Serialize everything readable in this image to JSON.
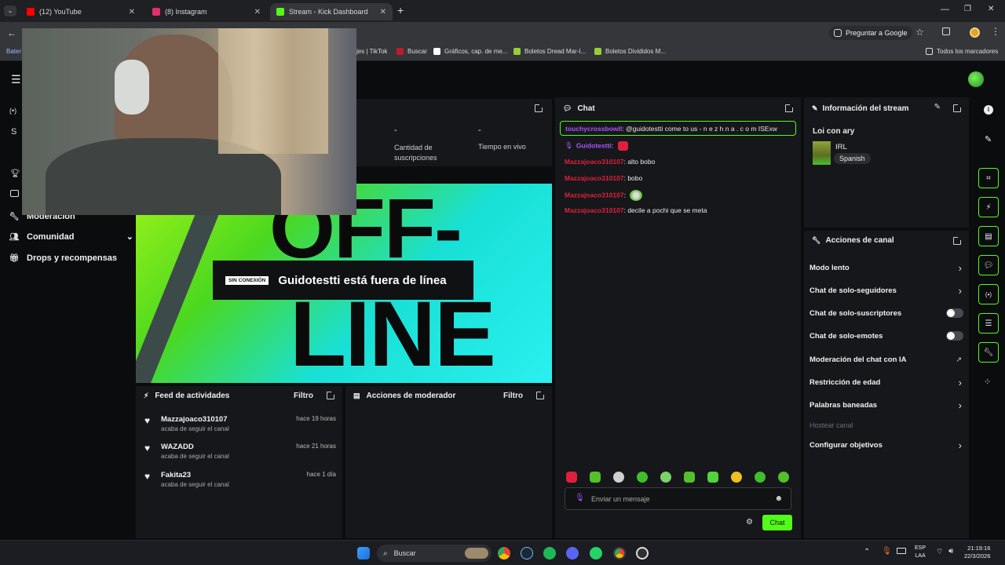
{
  "browser": {
    "tabs": [
      {
        "title": "(12) YouTube",
        "favicon": "youtube-icon",
        "color": "#ff0000"
      },
      {
        "title": "(8) Instagram",
        "favicon": "instagram-icon",
        "color": "#e1306c"
      },
      {
        "title": "Stream - Kick Dashboard",
        "favicon": "kick-icon",
        "color": "#53fc18"
      }
    ],
    "ask_google": "Preguntar a Google",
    "bookmarks": [
      {
        "label": "Bater",
        "icon": "bookmark-icon"
      },
      {
        "label": "jes | TikTok",
        "icon": "tiktok-icon"
      },
      {
        "label": "Buscar",
        "icon": "buscar-icon"
      },
      {
        "label": "Gráficos, cap. de me...",
        "icon": "capcut-icon"
      },
      {
        "label": "Boletos Dread Mar-I...",
        "icon": "ticket-icon"
      },
      {
        "label": "Boletos Divididos M...",
        "icon": "ticket-icon"
      }
    ],
    "all_bookmarks": "Todos los marcadores"
  },
  "sidebar": {
    "items": [
      {
        "label": "Moderación",
        "icon": "wrench-icon"
      },
      {
        "label": "Comunidad",
        "icon": "community-icon"
      },
      {
        "label": "Drops y recompensas",
        "icon": "gift-icon"
      }
    ]
  },
  "stats": [
    {
      "value": "-",
      "label": "Cantidad de suscripciones"
    },
    {
      "value": "-",
      "label": "Tiempo en vivo"
    }
  ],
  "player": {
    "offline_badge": "SIN CONEXIÓN",
    "offline_text": "Guidotestti está fuera de línea",
    "bg_word_1": "OFF-",
    "bg_word_2": "LINE"
  },
  "activity": {
    "title": "Feed de actividades",
    "filter": "Filtro",
    "items": [
      {
        "name": "Mazzajoaco310107",
        "sub": "acaba de seguir el canal",
        "time": "hace 19 horas"
      },
      {
        "name": "WAZADD",
        "sub": "acaba de seguir el canal",
        "time": "hace 21 horas"
      },
      {
        "name": "Fakita23",
        "sub": "acaba de seguir el canal",
        "time": "hace 1 día"
      }
    ]
  },
  "mod_actions": {
    "title": "Acciones de moderador",
    "filter": "Filtro"
  },
  "chat": {
    "title": "Chat",
    "pinned_user": "touchycrossbowll",
    "pinned_text": ": @guidotestti come to us - n e z h n a . c o m ISExw",
    "messages": [
      {
        "user": "Guidotestti",
        "text": ":",
        "color": "#a855f7"
      },
      {
        "user": "Mazzajoaco310107",
        "text": ": alto bobo",
        "color": "#e0203a"
      },
      {
        "user": "Mazzajoaco310107",
        "text": ": bobo",
        "color": "#e0203a"
      },
      {
        "user": "Mazzajoaco310107",
        "text": ":",
        "color": "#e0203a"
      },
      {
        "user": "Mazzajoaco310107",
        "text": ": decile a pochi que se meta",
        "color": "#e0203a"
      }
    ],
    "placeholder": "Enviar un mensaje",
    "send": "Chat"
  },
  "stream_info": {
    "title": "Información del stream",
    "stream_title": "Loi con ary",
    "category": "IRL",
    "language": "Spanish"
  },
  "channel_actions": {
    "title": "Acciones de canal",
    "items": [
      {
        "label": "Modo lento",
        "control": "chevron"
      },
      {
        "label": "Chat de solo-seguidores",
        "control": "chevron"
      },
      {
        "label": "Chat de solo-suscriptores",
        "control": "toggle"
      },
      {
        "label": "Chat de solo-emotes",
        "control": "toggle"
      },
      {
        "label": "Moderación del chat con IA",
        "control": "external"
      },
      {
        "label": "Restricción de edad",
        "control": "chevron"
      },
      {
        "label": "Palabras baneadas",
        "control": "chevron"
      },
      {
        "label": "Hostear canal",
        "control": "disabled"
      },
      {
        "label": "Configurar objetivos",
        "control": "chevron"
      }
    ]
  },
  "taskbar": {
    "search": "Buscar",
    "lang": "ESP",
    "region": "LAA",
    "time": "21:19:16",
    "date": "22/3/2026"
  },
  "colors": {
    "accent": "#53fc18",
    "panel": "#16171a",
    "bg": "#0b0c0e"
  }
}
